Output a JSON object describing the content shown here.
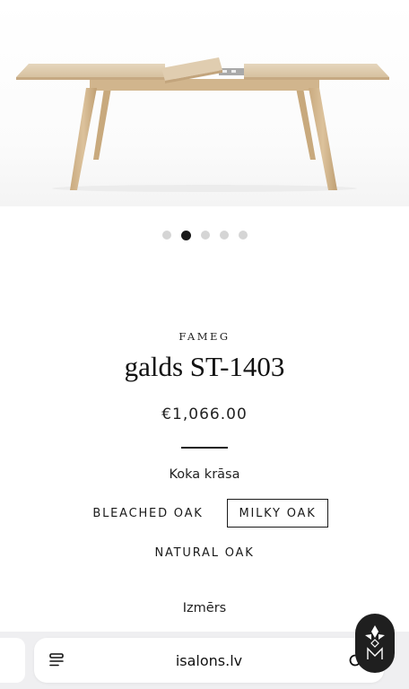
{
  "product": {
    "brand": "FAMEG",
    "title": "galds ST-1403",
    "price": "€1,066.00"
  },
  "gallery": {
    "slide_count": 5,
    "active_index": 1
  },
  "options": {
    "wood_color": {
      "label": "Koka krāsa",
      "choices": [
        "BLEACHED OAK",
        "MILKY OAK",
        "NATURAL OAK"
      ],
      "selected": "MILKY OAK"
    },
    "size": {
      "label": "Izmērs"
    }
  },
  "browser": {
    "url": "isalons.lv"
  }
}
